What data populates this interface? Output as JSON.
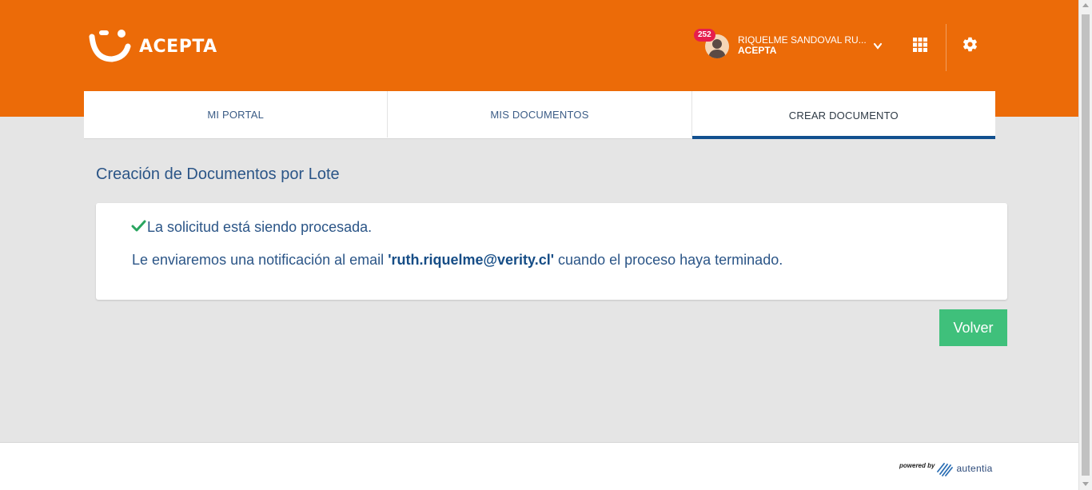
{
  "brand": {
    "name": "ACEPTA",
    "logo_icon": "smile-logo-icon"
  },
  "user": {
    "name": "RIQUELME SANDOVAL RU...",
    "company": "ACEPTA",
    "notification_count": "252",
    "avatar_icon": "user-avatar-icon"
  },
  "header_icons": {
    "dropdown": "chevron-down-icon",
    "apps": "apps-grid-icon",
    "settings": "gear-icon"
  },
  "tabs": [
    {
      "label": "MI PORTAL",
      "active": false
    },
    {
      "label": "MIS DOCUMENTOS",
      "active": false
    },
    {
      "label": "CREAR DOCUMENTO",
      "active": true
    }
  ],
  "main": {
    "title": "Creación de Documentos por Lote",
    "status_message": "La solicitud está siendo procesada.",
    "notification_prefix": "Le enviaremos una notificación al email ",
    "email": "'ruth.riquelme@verity.cl'",
    "notification_suffix": " cuando el proceso haya terminado.",
    "back_button": "Volver"
  },
  "footer": {
    "powered_by": "powered by",
    "provider": "autentia"
  },
  "colors": {
    "header": "#ec6b08",
    "accent": "#12508f",
    "text": "#2b5587",
    "success": "#3fc07b",
    "badge": "#e61e4d"
  }
}
